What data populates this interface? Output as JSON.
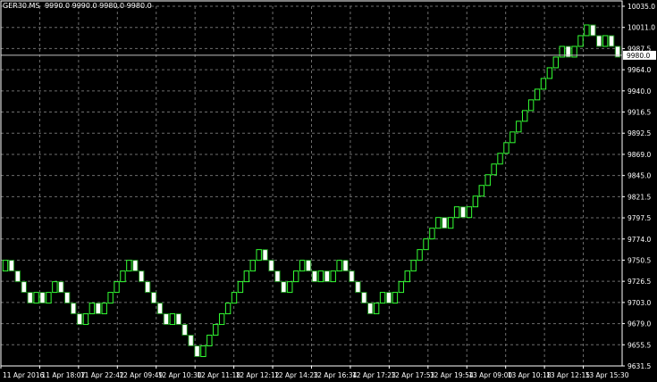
{
  "header": {
    "symbol": "GER30.MS",
    "ohlc": "9990.0 9990.0 9980.0 9980.0"
  },
  "colors": {
    "background": "#000000",
    "grid": "#6e6e6e",
    "axis": "#ffffff",
    "bull_body": "#000000",
    "bull_outline": "#33ff33",
    "bear_body": "#ffffff",
    "bear_outline": "#1a8c1a",
    "price_line": "#c0c0c0",
    "price_label_bg": "#ffffff",
    "price_label_text": "#000000"
  },
  "chart_data": {
    "type": "renko",
    "brick_size": 12,
    "ylim": [
      9631.5,
      10035.0
    ],
    "y_ticks": [
      "10035.0",
      "10011.0",
      "9987.5",
      "9964.0",
      "9940.0",
      "9916.5",
      "9892.5",
      "9869.0",
      "9845.0",
      "9821.5",
      "9797.5",
      "9774.0",
      "9750.5",
      "9726.5",
      "9703.0",
      "9679.0",
      "9655.5",
      "9631.5"
    ],
    "x_ticks": [
      "11 Apr 2016",
      "11 Apr 18:07",
      "11 Apr 22:42",
      "12 Apr 09:49",
      "12 Apr 10:30",
      "12 Apr 11:18",
      "12 Apr 12:12",
      "12 Apr 14:23",
      "12 Apr 16:34",
      "12 Apr 17:23",
      "12 Apr 17:53",
      "12 Apr 19:54",
      "13 Apr 09:00",
      "13 Apr 10:18",
      "13 Apr 12:15",
      "13 Apr 15:30"
    ],
    "current_price": 9980.0,
    "current_price_label": "9980.0",
    "grid": true,
    "bricks": [
      {
        "open": 9738,
        "close": 9750
      },
      {
        "open": 9750,
        "close": 9738
      },
      {
        "open": 9738,
        "close": 9726
      },
      {
        "open": 9726,
        "close": 9714
      },
      {
        "open": 9714,
        "close": 9702
      },
      {
        "open": 9702,
        "close": 9714
      },
      {
        "open": 9714,
        "close": 9702
      },
      {
        "open": 9702,
        "close": 9714
      },
      {
        "open": 9714,
        "close": 9726
      },
      {
        "open": 9726,
        "close": 9714
      },
      {
        "open": 9714,
        "close": 9702
      },
      {
        "open": 9702,
        "close": 9690
      },
      {
        "open": 9690,
        "close": 9678
      },
      {
        "open": 9678,
        "close": 9690
      },
      {
        "open": 9690,
        "close": 9702
      },
      {
        "open": 9702,
        "close": 9690
      },
      {
        "open": 9690,
        "close": 9702
      },
      {
        "open": 9702,
        "close": 9714
      },
      {
        "open": 9714,
        "close": 9726
      },
      {
        "open": 9726,
        "close": 9738
      },
      {
        "open": 9738,
        "close": 9750
      },
      {
        "open": 9750,
        "close": 9738
      },
      {
        "open": 9738,
        "close": 9726
      },
      {
        "open": 9726,
        "close": 9714
      },
      {
        "open": 9714,
        "close": 9702
      },
      {
        "open": 9702,
        "close": 9690
      },
      {
        "open": 9690,
        "close": 9678
      },
      {
        "open": 9678,
        "close": 9690
      },
      {
        "open": 9690,
        "close": 9678
      },
      {
        "open": 9678,
        "close": 9666
      },
      {
        "open": 9666,
        "close": 9654
      },
      {
        "open": 9654,
        "close": 9642
      },
      {
        "open": 9642,
        "close": 9654
      },
      {
        "open": 9654,
        "close": 9666
      },
      {
        "open": 9666,
        "close": 9678
      },
      {
        "open": 9678,
        "close": 9690
      },
      {
        "open": 9690,
        "close": 9702
      },
      {
        "open": 9702,
        "close": 9714
      },
      {
        "open": 9714,
        "close": 9726
      },
      {
        "open": 9726,
        "close": 9738
      },
      {
        "open": 9738,
        "close": 9750
      },
      {
        "open": 9750,
        "close": 9762
      },
      {
        "open": 9762,
        "close": 9750
      },
      {
        "open": 9750,
        "close": 9738
      },
      {
        "open": 9738,
        "close": 9726
      },
      {
        "open": 9726,
        "close": 9714
      },
      {
        "open": 9714,
        "close": 9726
      },
      {
        "open": 9726,
        "close": 9738
      },
      {
        "open": 9738,
        "close": 9750
      },
      {
        "open": 9750,
        "close": 9738
      },
      {
        "open": 9738,
        "close": 9726
      },
      {
        "open": 9726,
        "close": 9738
      },
      {
        "open": 9738,
        "close": 9726
      },
      {
        "open": 9726,
        "close": 9738
      },
      {
        "open": 9738,
        "close": 9750
      },
      {
        "open": 9750,
        "close": 9738
      },
      {
        "open": 9738,
        "close": 9726
      },
      {
        "open": 9726,
        "close": 9714
      },
      {
        "open": 9714,
        "close": 9702
      },
      {
        "open": 9702,
        "close": 9690
      },
      {
        "open": 9690,
        "close": 9702
      },
      {
        "open": 9702,
        "close": 9714
      },
      {
        "open": 9714,
        "close": 9702
      },
      {
        "open": 9702,
        "close": 9714
      },
      {
        "open": 9714,
        "close": 9726
      },
      {
        "open": 9726,
        "close": 9738
      },
      {
        "open": 9738,
        "close": 9750
      },
      {
        "open": 9750,
        "close": 9762
      },
      {
        "open": 9762,
        "close": 9774
      },
      {
        "open": 9774,
        "close": 9786
      },
      {
        "open": 9786,
        "close": 9798
      },
      {
        "open": 9798,
        "close": 9786
      },
      {
        "open": 9786,
        "close": 9798
      },
      {
        "open": 9798,
        "close": 9810
      },
      {
        "open": 9810,
        "close": 9798
      },
      {
        "open": 9798,
        "close": 9810
      },
      {
        "open": 9810,
        "close": 9822
      },
      {
        "open": 9822,
        "close": 9834
      },
      {
        "open": 9834,
        "close": 9846
      },
      {
        "open": 9846,
        "close": 9858
      },
      {
        "open": 9858,
        "close": 9870
      },
      {
        "open": 9870,
        "close": 9882
      },
      {
        "open": 9882,
        "close": 9894
      },
      {
        "open": 9894,
        "close": 9906
      },
      {
        "open": 9906,
        "close": 9918
      },
      {
        "open": 9918,
        "close": 9930
      },
      {
        "open": 9930,
        "close": 9942
      },
      {
        "open": 9942,
        "close": 9954
      },
      {
        "open": 9954,
        "close": 9966
      },
      {
        "open": 9966,
        "close": 9978
      },
      {
        "open": 9978,
        "close": 9990
      },
      {
        "open": 9990,
        "close": 9978
      },
      {
        "open": 9978,
        "close": 9990
      },
      {
        "open": 9990,
        "close": 10002
      },
      {
        "open": 10002,
        "close": 10014
      },
      {
        "open": 10014,
        "close": 10002
      },
      {
        "open": 10002,
        "close": 9990
      },
      {
        "open": 9990,
        "close": 10002
      },
      {
        "open": 10002,
        "close": 9990
      },
      {
        "open": 9990,
        "close": 9978
      }
    ]
  }
}
